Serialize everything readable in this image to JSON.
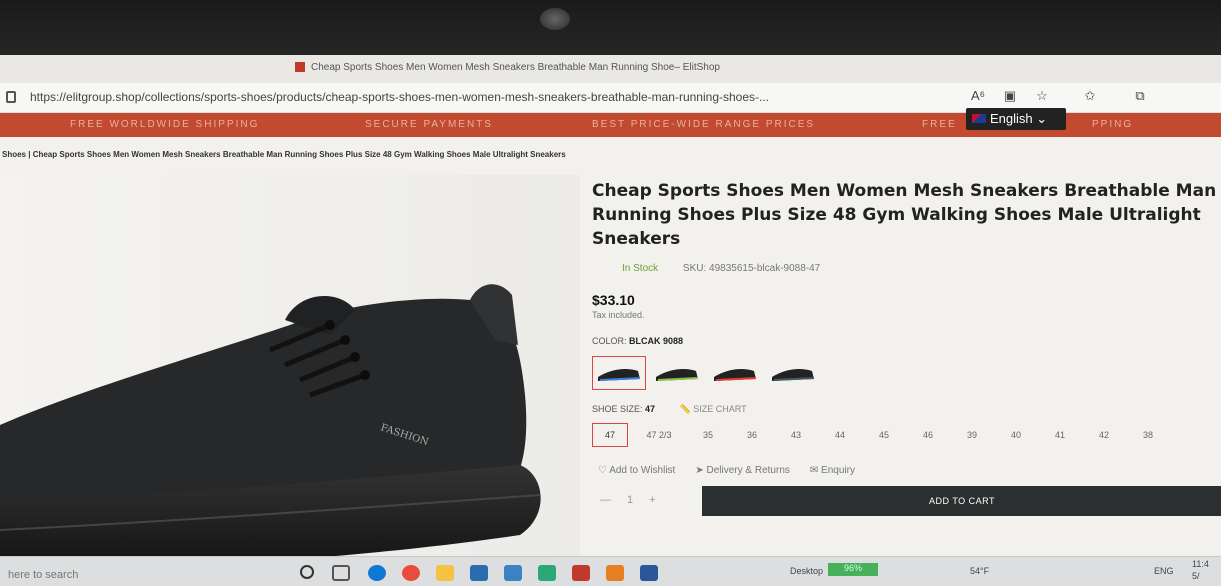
{
  "browser": {
    "tab_title": "Cheap Sports Shoes Men Women Mesh Sneakers Breathable Man Running Shoe– ElitShop",
    "url": "https://elitgroup.shop/collections/sports-shoes/products/cheap-sports-shoes-men-women-mesh-sneakers-breathable-man-running-shoes-...",
    "read_aloud_icon": "A⁶",
    "icons": [
      "read-aloud-icon",
      "split-view-icon",
      "favorite-add-icon",
      "favorites-icon",
      "collections-icon"
    ]
  },
  "promo_bar": {
    "items": [
      "FREE WORLDWIDE SHIPPING",
      "SECURE PAYMENTS",
      "BEST PRICE-WIDE RANGE PRICES",
      "FREE",
      "PPING"
    ]
  },
  "language": {
    "label": "English"
  },
  "breadcrumb": "Shoes  |  Cheap Sports Shoes Men Women Mesh Sneakers Breathable Man Running Shoes Plus Size 48 Gym Walking Shoes Male Ultralight Sneakers",
  "product": {
    "title": "Cheap Sports Shoes Men Women Mesh Sneakers Breathable Man Running Shoes Plus Size 48 Gym Walking Shoes Male Ultralight Sneakers",
    "stock": "In Stock",
    "sku": "SKU: 49835615-blcak-9088-47",
    "price": "$33.10",
    "tax_note": "Tax included.",
    "color_label": "COLOR:",
    "color_value": "BLCAK 9088",
    "swatch_accents": [
      "#3b7fd9",
      "#8bc34a",
      "#e53935",
      "#455a64"
    ],
    "size_label": "SHOE SIZE:",
    "size_value": "47",
    "size_chart": "SIZE CHART",
    "sizes": [
      "47",
      "47 2/3",
      "35",
      "36",
      "43",
      "44",
      "45",
      "46",
      "39",
      "40",
      "41",
      "42",
      "38"
    ],
    "selected_size": "47",
    "shoe_text": "FASHION",
    "links": [
      "Add to Wishlist",
      "Delivery & Returns",
      "Enquiry"
    ],
    "quantity": "1",
    "qty_minus": "—",
    "qty_plus": "+",
    "add_to_cart": "ADD TO CART"
  },
  "taskbar": {
    "search": "here to search",
    "desktop": "Desktop",
    "battery": "96%",
    "temp": "54°F",
    "lang": "ENG",
    "time": "11:4",
    "date": "5/"
  }
}
